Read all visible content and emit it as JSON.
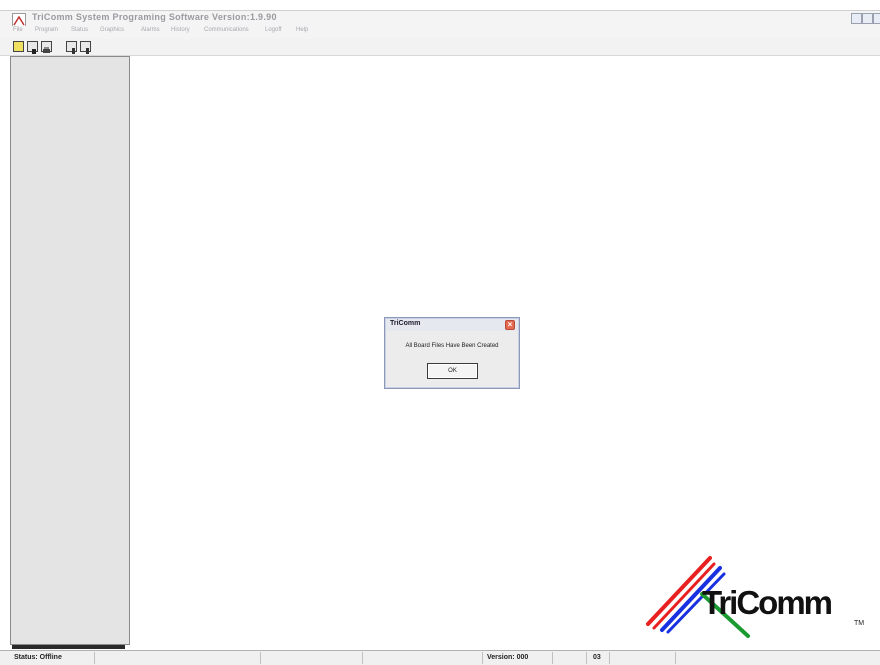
{
  "window": {
    "title": "TriComm System Programing Software  Version:1.9.90"
  },
  "menu": [
    "File",
    "Program",
    "Status",
    "Graphics",
    "Alarms",
    "History",
    "Communications",
    "Logoff",
    "Help"
  ],
  "dialog": {
    "title": "TriComm",
    "message": "All Board Files Have Been Created",
    "ok_label": "OK"
  },
  "status": {
    "status_text": "Status: Offline",
    "version_text": "Version: 000",
    "code_text": "03"
  },
  "logo": {
    "text": "TriComm",
    "tm": "TM"
  },
  "colors": {
    "logo_red": "#e82020",
    "logo_blue": "#1830e0",
    "logo_green": "#1a9a30"
  }
}
